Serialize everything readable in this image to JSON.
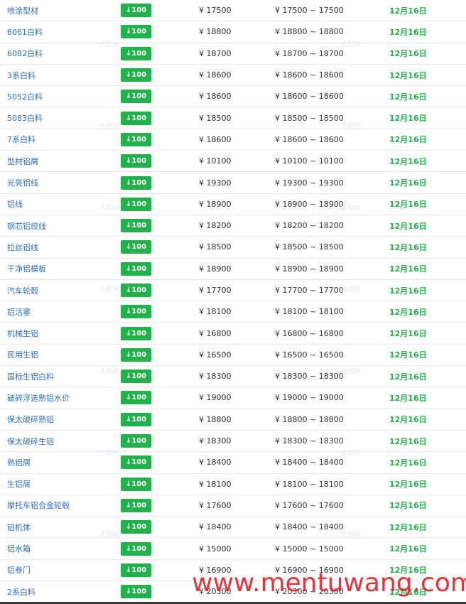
{
  "currency_symbol": "¥",
  "range_separator": "~",
  "colors": {
    "name": "#2f6fbf",
    "badge": "#22b14c",
    "date": "#22b14c",
    "watermark": "#e8212a"
  },
  "rows": [
    {
      "name": "喷涂型材",
      "change": "↓100",
      "price": "¥ 17500",
      "range": "¥ 17500 ~ 17500",
      "date": "12月16日"
    },
    {
      "name": "6061白料",
      "change": "↓100",
      "price": "¥ 18800",
      "range": "¥ 18800 ~ 18800",
      "date": "12月16日"
    },
    {
      "name": "6082白料",
      "change": "↓100",
      "price": "¥ 18700",
      "range": "¥ 18700 ~ 18700",
      "date": "12月16日"
    },
    {
      "name": "3系白料",
      "change": "↓100",
      "price": "¥ 18600",
      "range": "¥ 18600 ~ 18600",
      "date": "12月16日"
    },
    {
      "name": "5052白料",
      "change": "↓100",
      "price": "¥ 18600",
      "range": "¥ 18600 ~ 18600",
      "date": "12月16日"
    },
    {
      "name": "5083白料",
      "change": "↓100",
      "price": "¥ 18500",
      "range": "¥ 18500 ~ 18500",
      "date": "12月16日"
    },
    {
      "name": "7系白料",
      "change": "↓100",
      "price": "¥ 18600",
      "range": "¥ 18600 ~ 18600",
      "date": "12月16日"
    },
    {
      "name": "型材铝屑",
      "change": "↓100",
      "price": "¥ 10100",
      "range": "¥ 10100 ~ 10100",
      "date": "12月16日"
    },
    {
      "name": "光亮铝线",
      "change": "↓100",
      "price": "¥ 19300",
      "range": "¥ 19300 ~ 19300",
      "date": "12月16日"
    },
    {
      "name": "铝线",
      "change": "↓100",
      "price": "¥ 18900",
      "range": "¥ 18900 ~ 18900",
      "date": "12月16日"
    },
    {
      "name": "钢芯铝绞线",
      "change": "↓100",
      "price": "¥ 18200",
      "range": "¥ 18200 ~ 18200",
      "date": "12月16日"
    },
    {
      "name": "拉丝铝线",
      "change": "↓100",
      "price": "¥ 18500",
      "range": "¥ 18500 ~ 18500",
      "date": "12月16日"
    },
    {
      "name": "干净铝模板",
      "change": "↓100",
      "price": "¥ 18900",
      "range": "¥ 18900 ~ 18900",
      "date": "12月16日"
    },
    {
      "name": "汽车轮毂",
      "change": "↓100",
      "price": "¥ 17700",
      "range": "¥ 17700 ~ 17700",
      "date": "12月16日"
    },
    {
      "name": "铝活塞",
      "change": "↓100",
      "price": "¥ 18100",
      "range": "¥ 18100 ~ 18100",
      "date": "12月16日"
    },
    {
      "name": "机械生铝",
      "change": "↓100",
      "price": "¥ 16800",
      "range": "¥ 16800 ~ 16800",
      "date": "12月16日"
    },
    {
      "name": "民用生铝",
      "change": "↓100",
      "price": "¥ 16500",
      "range": "¥ 16500 ~ 16500",
      "date": "12月16日"
    },
    {
      "name": "国标生铝白料",
      "change": "↓100",
      "price": "¥ 18300",
      "range": "¥ 18300 ~ 18300",
      "date": "12月16日"
    },
    {
      "name": "破碎浮选熟铝水价",
      "change": "↓100",
      "price": "¥ 19000",
      "range": "¥ 19000 ~ 19000",
      "date": "12月16日"
    },
    {
      "name": "保太破碎熟铝",
      "change": "↓100",
      "price": "¥ 18800",
      "range": "¥ 18800 ~ 18800",
      "date": "12月16日"
    },
    {
      "name": "保太破碎生铝",
      "change": "↓100",
      "price": "¥ 18300",
      "range": "¥ 18300 ~ 18300",
      "date": "12月16日"
    },
    {
      "name": "熟铝屑",
      "change": "↓100",
      "price": "¥ 18400",
      "range": "¥ 18400 ~ 18400",
      "date": "12月16日"
    },
    {
      "name": "生铝屑",
      "change": "↓100",
      "price": "¥ 18100",
      "range": "¥ 18100 ~ 18100",
      "date": "12月16日"
    },
    {
      "name": "摩托车铝合金轮毂",
      "change": "↓100",
      "price": "¥ 17600",
      "range": "¥ 17600 ~ 17600",
      "date": "12月16日"
    },
    {
      "name": "铝机体",
      "change": "↓100",
      "price": "¥ 18400",
      "range": "¥ 18400 ~ 18400",
      "date": "12月16日"
    },
    {
      "name": "铝水箱",
      "change": "↓100",
      "price": "¥ 15000",
      "range": "¥ 15000 ~ 15000",
      "date": "12月16日"
    },
    {
      "name": "铝卷门",
      "change": "↓100",
      "price": "¥ 16900",
      "range": "¥ 16900 ~ 16900",
      "date": "12月16日"
    },
    {
      "name": "2系白料",
      "change": "↓100",
      "price": "¥ 20300",
      "range": "¥ 20300 ~ 20300",
      "date": "12月16日"
    }
  ],
  "watermark_site": "www.mentuwang.com",
  "watermark_faint": "大损网"
}
